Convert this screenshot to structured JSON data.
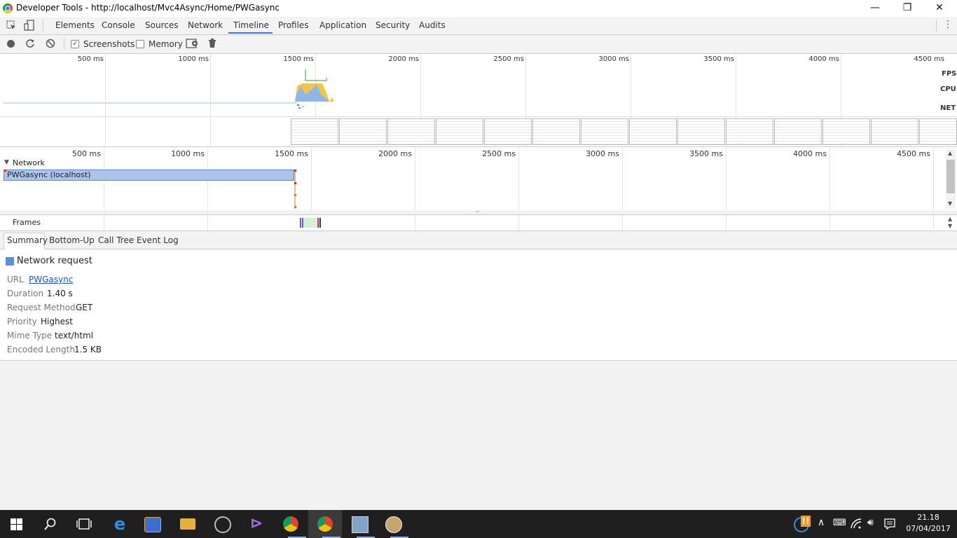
{
  "window": {
    "title": "Developer Tools - http://localhost/Mvc4Async/Home/PWGasync",
    "minimize": "—",
    "maximize": "❐",
    "close": "✕"
  },
  "tabs": [
    {
      "label": "Elements"
    },
    {
      "label": "Console"
    },
    {
      "label": "Sources"
    },
    {
      "label": "Network"
    },
    {
      "label": "Timeline",
      "active": true
    },
    {
      "label": "Profiles"
    },
    {
      "label": "Application"
    },
    {
      "label": "Security"
    },
    {
      "label": "Audits"
    }
  ],
  "toolbar": {
    "screenshots_label": "Screenshots",
    "screenshots_checked": true,
    "memory_label": "Memory",
    "memory_checked": false
  },
  "overview": {
    "ticks": [
      "500 ms",
      "1000 ms",
      "1500 ms",
      "2000 ms",
      "2500 ms",
      "3000 ms",
      "3500 ms",
      "4000 ms",
      "4500 ms"
    ],
    "fps_label": "FPS",
    "cpu_label": "CPU",
    "net_label": "NET"
  },
  "flame": {
    "ticks": [
      "500 ms",
      "1000 ms",
      "1500 ms",
      "2000 ms",
      "2500 ms",
      "3000 ms",
      "3500 ms",
      "4000 ms",
      "4500 ms"
    ],
    "network_section": "Network",
    "request_label": "PWGasync (localhost)",
    "frames_label": "Frames"
  },
  "detail_tabs": [
    {
      "label": "Summary",
      "active": true
    },
    {
      "label": "Bottom-Up"
    },
    {
      "label": "Call Tree"
    },
    {
      "label": "Event Log"
    }
  ],
  "summary": {
    "heading": "Network request",
    "color": "#5b8fd9",
    "rows": [
      {
        "key": "URL",
        "value": "PWGasync",
        "link": true
      },
      {
        "key": "Duration",
        "value": "1.40 s"
      },
      {
        "key": "Request Method",
        "value": "GET"
      },
      {
        "key": "Priority",
        "value": "Highest"
      },
      {
        "key": "Mime Type",
        "value": "text/html"
      },
      {
        "key": "Encoded Length",
        "value": "1.5 KB"
      }
    ]
  },
  "taskbar": {
    "time": "21.18",
    "date": "07/04/2017"
  }
}
